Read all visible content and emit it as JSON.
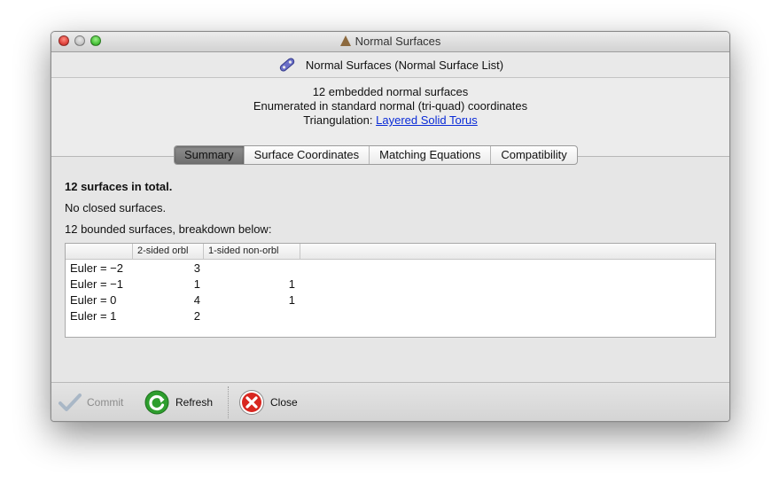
{
  "window": {
    "title": "Normal Surfaces",
    "controls": [
      "close",
      "minimize",
      "zoom"
    ]
  },
  "header": {
    "label": "Normal Surfaces (Normal Surface List)",
    "icon": "packet-link-icon"
  },
  "info": {
    "line1": "12 embedded normal surfaces",
    "line2": "Enumerated in standard normal (tri-quad) coordinates",
    "triangulation_prefix": "Triangulation:",
    "triangulation_link": "Layered Solid Torus"
  },
  "tabs": [
    {
      "label": "Summary",
      "active": true
    },
    {
      "label": "Surface Coordinates",
      "active": false
    },
    {
      "label": "Matching Equations",
      "active": false
    },
    {
      "label": "Compatibility",
      "active": false
    }
  ],
  "summary": {
    "total": "12 surfaces in total.",
    "closed": "No closed surfaces.",
    "bounded": "12 bounded surfaces, breakdown below:",
    "table": {
      "columns": [
        "",
        "2-sided orbl",
        "1-sided non-orbl"
      ],
      "rows": [
        [
          "Euler = −2",
          "3",
          ""
        ],
        [
          "Euler = −1",
          "1",
          "1"
        ],
        [
          "Euler = 0",
          "4",
          "1"
        ],
        [
          "Euler = 1",
          "2",
          ""
        ]
      ]
    }
  },
  "toolbar": {
    "commit_label": "Commit",
    "commit_enabled": false,
    "refresh_label": "Refresh",
    "close_label": "Close"
  },
  "colors": {
    "link": "#0a2bd7",
    "close_red": "#d8261f",
    "refresh_green": "#2e9e2e",
    "active_tab": "#7d7d7d"
  }
}
